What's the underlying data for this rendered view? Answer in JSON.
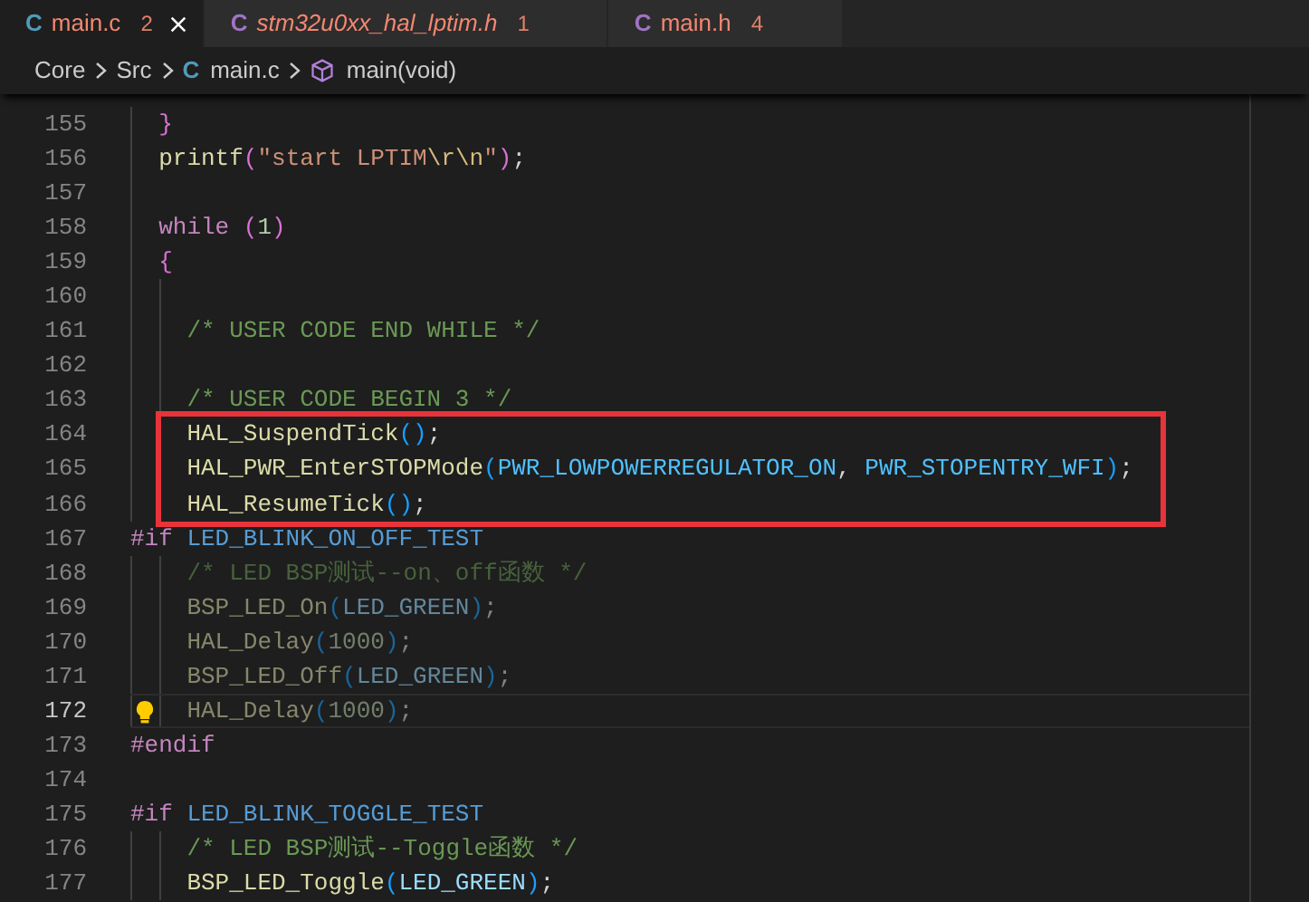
{
  "tabs": [
    {
      "kind": "c",
      "icon": "C",
      "label": "main.c",
      "problems": "2",
      "selected": true,
      "preview": false
    },
    {
      "kind": "h",
      "icon": "C",
      "label": "stm32u0xx_hal_lptim.h",
      "problems": "1",
      "selected": false,
      "preview": true
    },
    {
      "kind": "h",
      "icon": "C",
      "label": "main.h",
      "problems": "4",
      "selected": false,
      "preview": false
    }
  ],
  "breadcrumb": [
    {
      "kind": "folder",
      "label": "Core"
    },
    {
      "kind": "folder",
      "label": "Src"
    },
    {
      "kind": "c",
      "icon": "C",
      "label": "main.c"
    },
    {
      "kind": "symbol",
      "label": "main(void)"
    }
  ],
  "lines": [
    {
      "number": "155",
      "kind": "block",
      "current": false,
      "inactive": false,
      "boxed": false,
      "words": [
        [
          {
            "kind": "bracket2",
            "text": "}"
          }
        ]
      ]
    },
    {
      "number": "156",
      "kind": "block",
      "current": false,
      "inactive": false,
      "boxed": false,
      "words": [
        [
          {
            "kind": "fn",
            "text": "printf"
          },
          {
            "kind": "bracket2",
            "text": "("
          },
          {
            "kind": "string",
            "text": "\"start"
          }
        ],
        [
          {
            "kind": "string",
            "text": "LPTIM"
          },
          {
            "kind": "escape",
            "text": "\\r\\n"
          },
          {
            "kind": "string",
            "text": "\""
          },
          {
            "kind": "bracket2",
            "text": ")"
          },
          {
            "kind": "punct",
            "text": ";"
          }
        ]
      ]
    },
    {
      "number": "157",
      "kind": "block",
      "current": false,
      "boxed": false
    },
    {
      "number": "158",
      "kind": "block",
      "current": false,
      "inactive": false,
      "boxed": false,
      "words": [
        [
          {
            "kind": "keyword",
            "text": "while"
          }
        ],
        [
          {
            "kind": "bracket2",
            "text": "("
          },
          {
            "kind": "number",
            "text": "1"
          },
          {
            "kind": "bracket2",
            "text": ")"
          }
        ]
      ]
    },
    {
      "number": "159",
      "kind": "block",
      "current": false,
      "inactive": false,
      "boxed": false,
      "words": [
        [
          {
            "kind": "bracket2",
            "text": "{"
          }
        ]
      ]
    },
    {
      "number": "160",
      "kind": "inner",
      "current": false,
      "boxed": false
    },
    {
      "number": "161",
      "kind": "inner",
      "current": false,
      "inactive": false,
      "boxed": false,
      "words": [
        [
          {
            "kind": "comment",
            "text": "/* USER CODE END WHILE */"
          }
        ]
      ]
    },
    {
      "number": "162",
      "kind": "inner",
      "current": false,
      "boxed": false
    },
    {
      "number": "163",
      "kind": "inner",
      "current": false,
      "inactive": false,
      "boxed": false,
      "words": [
        [
          {
            "kind": "comment",
            "text": "/* USER CODE BEGIN 3 */"
          }
        ]
      ]
    },
    {
      "number": "164",
      "kind": "inner",
      "current": false,
      "inactive": false,
      "boxed": true,
      "words": [
        [
          {
            "kind": "fn",
            "text": "HAL_SuspendTick"
          },
          {
            "kind": "bracket3",
            "text": "()"
          },
          {
            "kind": "punct",
            "text": ";"
          }
        ]
      ]
    },
    {
      "number": "165",
      "kind": "inner",
      "current": false,
      "inactive": false,
      "boxed": true,
      "words": [
        [
          {
            "kind": "fn",
            "text": "HAL_PWR_EnterSTOPMode"
          },
          {
            "kind": "bracket3",
            "text": "("
          },
          {
            "kind": "constant",
            "text": "PWR_LOWPOWERREGULATOR_ON"
          },
          {
            "kind": "punct",
            "text": ","
          }
        ],
        [
          {
            "kind": "constant",
            "text": "PWR_STOPENTRY_WFI"
          },
          {
            "kind": "bracket3",
            "text": ")"
          },
          {
            "kind": "punct",
            "text": ";"
          }
        ]
      ]
    },
    {
      "number": "166",
      "kind": "inner",
      "current": false,
      "inactive": false,
      "boxed": true,
      "words": [
        [
          {
            "kind": "fn",
            "text": "HAL_ResumeTick"
          },
          {
            "kind": "bracket3",
            "text": "()"
          },
          {
            "kind": "punct",
            "text": ";"
          }
        ]
      ]
    },
    {
      "number": "167",
      "kind": "outer",
      "current": false,
      "inactive": false,
      "boxed": false,
      "words": [
        [
          {
            "kind": "keyword",
            "text": "#if"
          }
        ],
        [
          {
            "kind": "macro",
            "text": "LED_BLINK_ON_OFF_TEST"
          }
        ]
      ]
    },
    {
      "number": "168",
      "kind": "inner",
      "current": false,
      "inactive": true,
      "boxed": false,
      "words": [
        [
          {
            "kind": "comment",
            "text": "/* LED BSP测试--on、off函数 */"
          }
        ]
      ]
    },
    {
      "number": "169",
      "kind": "inner",
      "current": false,
      "inactive": true,
      "boxed": false,
      "words": [
        [
          {
            "kind": "fn",
            "text": "BSP_LED_On"
          },
          {
            "kind": "bracket3",
            "text": "("
          },
          {
            "kind": "variable",
            "text": "LED_GREEN"
          },
          {
            "kind": "bracket3",
            "text": ")"
          },
          {
            "kind": "punct",
            "text": ";"
          }
        ]
      ]
    },
    {
      "number": "170",
      "kind": "inner",
      "current": false,
      "inactive": true,
      "boxed": false,
      "words": [
        [
          {
            "kind": "fn",
            "text": "HAL_Delay"
          },
          {
            "kind": "bracket3",
            "text": "("
          },
          {
            "kind": "number",
            "text": "1000"
          },
          {
            "kind": "bracket3",
            "text": ")"
          },
          {
            "kind": "punct",
            "text": ";"
          }
        ]
      ]
    },
    {
      "number": "171",
      "kind": "inner",
      "current": false,
      "inactive": true,
      "boxed": false,
      "words": [
        [
          {
            "kind": "fn",
            "text": "BSP_LED_Off"
          },
          {
            "kind": "bracket3",
            "text": "("
          },
          {
            "kind": "variable",
            "text": "LED_GREEN"
          },
          {
            "kind": "bracket3",
            "text": ")"
          },
          {
            "kind": "punct",
            "text": ";"
          }
        ]
      ]
    },
    {
      "number": "172",
      "kind": "inner",
      "current": true,
      "inactive": true,
      "boxed": false,
      "words": [
        [
          {
            "kind": "fn",
            "text": "HAL_Delay"
          },
          {
            "kind": "bracket3",
            "text": "("
          },
          {
            "kind": "number",
            "text": "1000"
          },
          {
            "kind": "bracket3",
            "text": ")"
          },
          {
            "kind": "punct",
            "text": ";"
          }
        ]
      ]
    },
    {
      "number": "173",
      "kind": "outer",
      "current": false,
      "inactive": false,
      "boxed": false,
      "words": [
        [
          {
            "kind": "keyword",
            "text": "#endif"
          }
        ]
      ]
    },
    {
      "number": "174",
      "kind": "outer",
      "current": false,
      "boxed": false
    },
    {
      "number": "175",
      "kind": "outer",
      "current": false,
      "inactive": false,
      "boxed": false,
      "words": [
        [
          {
            "kind": "keyword",
            "text": "#if"
          }
        ],
        [
          {
            "kind": "macro",
            "text": "LED_BLINK_TOGGLE_TEST"
          }
        ]
      ]
    },
    {
      "number": "176",
      "kind": "inner",
      "current": false,
      "inactive": false,
      "boxed": false,
      "words": [
        [
          {
            "kind": "comment",
            "text": "/* LED BSP测试--Toggle函数 */"
          }
        ]
      ]
    },
    {
      "number": "177",
      "kind": "inner",
      "current": false,
      "inactive": false,
      "boxed": false,
      "words": [
        [
          {
            "kind": "fn",
            "text": "BSP_LED_Toggle"
          },
          {
            "kind": "bracket3",
            "text": "("
          },
          {
            "kind": "variable",
            "text": "LED_GREEN"
          },
          {
            "kind": "bracket3",
            "text": ")"
          },
          {
            "kind": "punct",
            "text": ";"
          }
        ]
      ]
    }
  ]
}
